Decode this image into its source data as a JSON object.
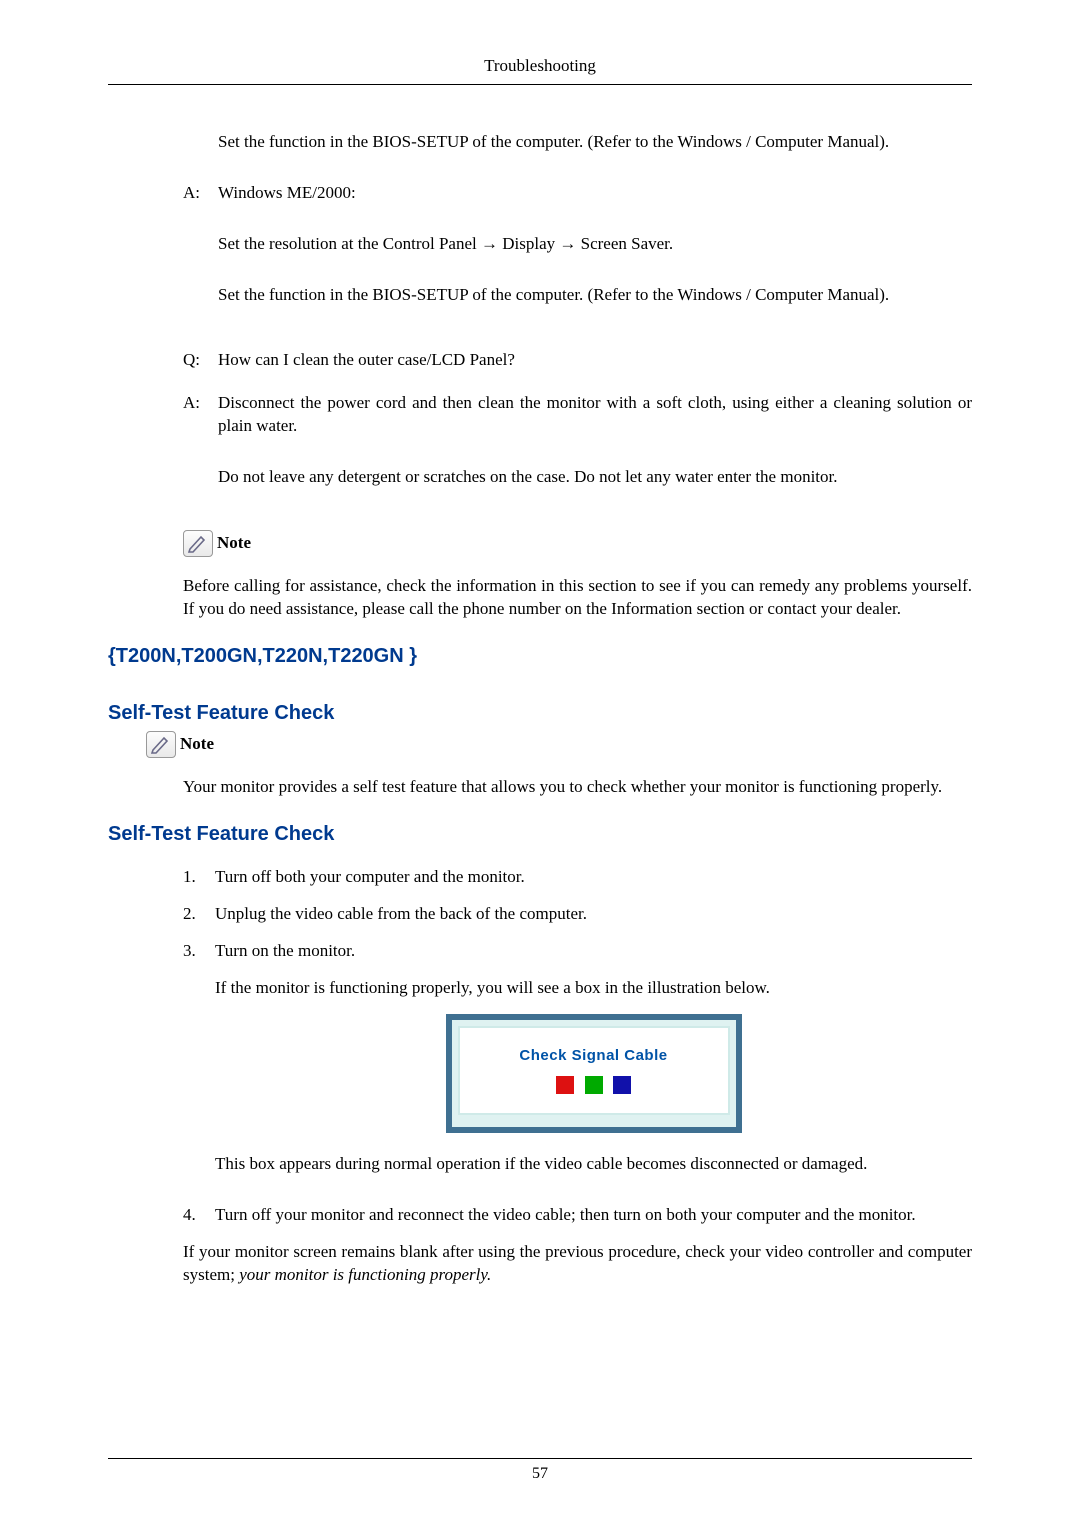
{
  "header": {
    "title": "Troubleshooting"
  },
  "top": {
    "a0_body1": "Set the function in the BIOS-SETUP of the computer. (Refer to the Windows / Computer Manual).",
    "a1_label": "A:",
    "a1_line1": "Windows ME/2000:",
    "a1_line2": "Set the resolution at the Control Panel → Display → Screen Saver.",
    "a1_line3": "Set the function in the BIOS-SETUP of the computer. (Refer to the Windows / Computer Manual).",
    "q2_label": "Q:",
    "q2_text": "How can I clean the outer case/LCD Panel?",
    "a2_label": "A:",
    "a2_line1": "Disconnect the power cord and then clean the monitor with a soft cloth, using either a cleaning solution or plain water.",
    "a2_line2": "Do not leave any detergent or scratches on the case. Do not let any water enter the monitor."
  },
  "note1": {
    "label": "Note",
    "body": "Before calling for assistance, check the information in this section to see if you can remedy any problems yourself. If you do need assistance, please call the phone number on the Information section or contact your dealer."
  },
  "models": "{T200N,T200GN,T220N,T220GN }",
  "sec1": {
    "title": "Self-Test Feature Check",
    "note_label": "Note",
    "body": "Your monitor provides a self test feature that allows you to check whether your monitor is functioning properly."
  },
  "sec2": {
    "title": "Self-Test Feature Check",
    "steps": [
      "Turn off both your computer and the monitor.",
      "Unplug the video cable from the back of the computer.",
      "Turn on the monitor."
    ],
    "s3_after": "If the monitor is functioning properly, you will see a box in the illustration below.",
    "fig_text": "Check Signal Cable",
    "s3_after2": "This box appears during normal operation if the video cable becomes disconnected or damaged.",
    "s4": "Turn off your monitor and reconnect the video cable; then turn on both your computer and the monitor.",
    "closing_a": "If your monitor screen remains blank after using the previous procedure, check your video controller and computer system; ",
    "closing_b": "your monitor is functioning properly."
  },
  "footer": {
    "page": "57"
  }
}
